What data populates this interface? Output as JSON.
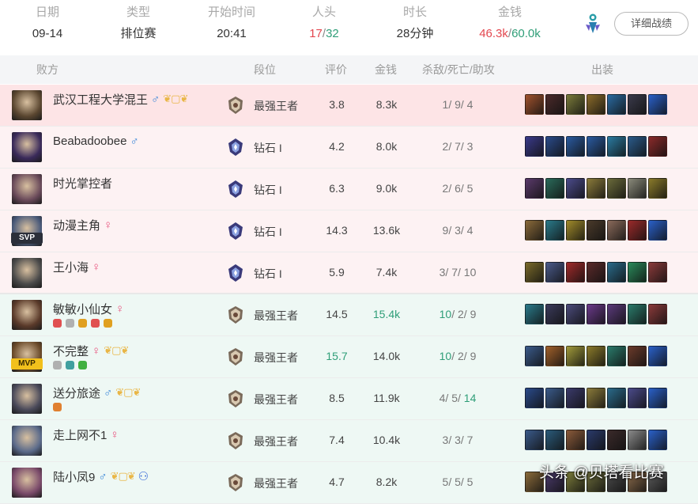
{
  "summary": {
    "date_label": "日期",
    "date": "09-14",
    "type_label": "类型",
    "type": "排位赛",
    "start_label": "开始时间",
    "start": "20:41",
    "kills_label": "人头",
    "kills_team": "17",
    "kills_total": "32",
    "duration_label": "时长",
    "duration": "28分钟",
    "gold_label": "金钱",
    "gold_team": "46.3k",
    "gold_total": "60.0k",
    "detail_button": "详细战绩"
  },
  "table_header": {
    "team": "败方",
    "rank": "段位",
    "score": "评价",
    "gold": "金钱",
    "kda": "杀敌/死亡/助攻",
    "items": "出装"
  },
  "players": [
    {
      "name": "武汉工程大学混王",
      "gender": "male",
      "laurel": true,
      "friend": false,
      "rank": "最强王者",
      "rank_icon": "master",
      "score": "3.8",
      "gold": "8.3k",
      "kda": [
        "1",
        "9",
        "4"
      ],
      "outcome": "lose",
      "self": true,
      "badge": "",
      "avatar_color": "#5a4630",
      "tags": [],
      "items": [
        "#a0522d",
        "#4a2a2a",
        "#7a7a3a",
        "#8a6a2a",
        "#2a6aa0",
        "#3a3a4a",
        "#2a60c8"
      ]
    },
    {
      "name": "Beabadoobee",
      "gender": "male",
      "laurel": false,
      "friend": false,
      "rank": "钻石 I",
      "rank_icon": "diamond",
      "score": "4.2",
      "gold": "8.0k",
      "kda": [
        "2",
        "7",
        "3"
      ],
      "outcome": "lose",
      "self": false,
      "badge": "",
      "avatar_color": "#3a2a5a",
      "tags": [],
      "items": [
        "#3a3a8a",
        "#2a4a8a",
        "#2a5aa0",
        "#2a5aa0",
        "#2a7aa0",
        "#2a5a8a",
        "#8a2a2a"
      ]
    },
    {
      "name": "时光掌控者",
      "gender": "",
      "laurel": false,
      "friend": false,
      "rank": "钻石 I",
      "rank_icon": "diamond",
      "score": "6.3",
      "gold": "9.0k",
      "kda": [
        "2",
        "6",
        "5"
      ],
      "outcome": "lose",
      "self": false,
      "badge": "",
      "avatar_color": "#6a4a5a",
      "tags": [],
      "items": [
        "#5a3a6a",
        "#2a6a5a",
        "#4a4a8a",
        "#8a7a3a",
        "#6a6a3a",
        "#8a8a7a",
        "#8a7a2a"
      ]
    },
    {
      "name": "动漫主角",
      "gender": "female",
      "laurel": false,
      "friend": false,
      "rank": "钻石 I",
      "rank_icon": "diamond",
      "score": "14.3",
      "gold": "13.6k",
      "kda": [
        "9",
        "3",
        "4"
      ],
      "outcome": "lose",
      "self": false,
      "badge": "SVP",
      "avatar_color": "#4a5a7a",
      "tags": [],
      "items": [
        "#8a6a3a",
        "#2a7a8a",
        "#a08a2a",
        "#4a3a2a",
        "#8a6a5a",
        "#9a2a2a",
        "#2a60c8"
      ]
    },
    {
      "name": "王小海",
      "gender": "female",
      "laurel": false,
      "friend": false,
      "rank": "钻石 I",
      "rank_icon": "diamond",
      "score": "5.9",
      "gold": "7.4k",
      "kda": [
        "3",
        "7",
        "10"
      ],
      "outcome": "lose",
      "self": false,
      "badge": "",
      "avatar_color": "#4a4a4a",
      "tags": [],
      "items": [
        "#7a6a2a",
        "#4a5a8a",
        "#a02a2a",
        "#5a2a2a",
        "#2a6a8a",
        "#2a8a5a",
        "#8a3a3a"
      ]
    },
    {
      "name": "敏敏小仙女",
      "gender": "female",
      "laurel": false,
      "friend": false,
      "rank": "最强王者",
      "rank_icon": "master",
      "score": "14.5",
      "gold": "15.4k",
      "kda": [
        "10",
        "2",
        "9"
      ],
      "outcome": "win",
      "self": false,
      "badge": "",
      "avatar_color": "#5a3a2a",
      "tags": [
        "#e05050",
        "#b0b0b0",
        "#e0a020",
        "#e05050",
        "#e0a020"
      ],
      "items": [
        "#2a7a8a",
        "#3a3a5a",
        "#4a4a7a",
        "#6a3a8a",
        "#5a3a7a",
        "#2a7a6a",
        "#8a3a3a"
      ]
    },
    {
      "name": "不完整",
      "gender": "female",
      "laurel": true,
      "friend": false,
      "rank": "最强王者",
      "rank_icon": "master",
      "score": "15.7",
      "gold": "14.0k",
      "kda": [
        "10",
        "2",
        "9"
      ],
      "outcome": "win",
      "self": false,
      "badge": "MVP",
      "avatar_color": "#6a4a2a",
      "tags": [
        "#b0b0b0",
        "#40a0a0",
        "#40b040"
      ],
      "items": [
        "#3a5a8a",
        "#a0602a",
        "#a09a3a",
        "#8a7a2a",
        "#2a7a6a",
        "#6a3a2a",
        "#2a60c8"
      ]
    },
    {
      "name": "送分旅途",
      "gender": "male",
      "laurel": true,
      "friend": false,
      "rank": "最强王者",
      "rank_icon": "master",
      "score": "8.5",
      "gold": "11.9k",
      "kda": [
        "4",
        "5",
        "14"
      ],
      "outcome": "win",
      "self": false,
      "badge": "",
      "avatar_color": "#4a4a5a",
      "tags": [
        "#e08030"
      ],
      "items": [
        "#2a4a8a",
        "#3a5a8a",
        "#3a3a6a",
        "#8a7a3a",
        "#2a6a8a",
        "#4a4a8a",
        "#2a60c8"
      ]
    },
    {
      "name": "走上网不1",
      "gender": "female",
      "laurel": false,
      "friend": false,
      "rank": "最强王者",
      "rank_icon": "master",
      "score": "7.4",
      "gold": "10.4k",
      "kda": [
        "3",
        "3",
        "7"
      ],
      "outcome": "win",
      "self": false,
      "badge": "",
      "avatar_color": "#5a6a8a",
      "tags": [],
      "items": [
        "#3a5a8a",
        "#2a5a7a",
        "#8a5a3a",
        "#2a3a6a",
        "#3a2a2a",
        "#8a8a8a",
        "#2a60c8"
      ]
    },
    {
      "name": "陆小凤9",
      "gender": "male",
      "laurel": true,
      "friend": true,
      "rank": "最强王者",
      "rank_icon": "master",
      "score": "4.7",
      "gold": "8.2k",
      "kda": [
        "5",
        "5",
        "5"
      ],
      "outcome": "win",
      "self": false,
      "badge": "",
      "avatar_color": "#7a4a6a",
      "tags": [],
      "items": [
        "#8a6a3a",
        "#4a3a6a",
        "#7a7a3a",
        "#6a6a3a",
        "#4a4a4a",
        "#8a6a4a",
        "#5a5a5a"
      ]
    }
  ],
  "watermark": "头条 @贝塔看比赛"
}
